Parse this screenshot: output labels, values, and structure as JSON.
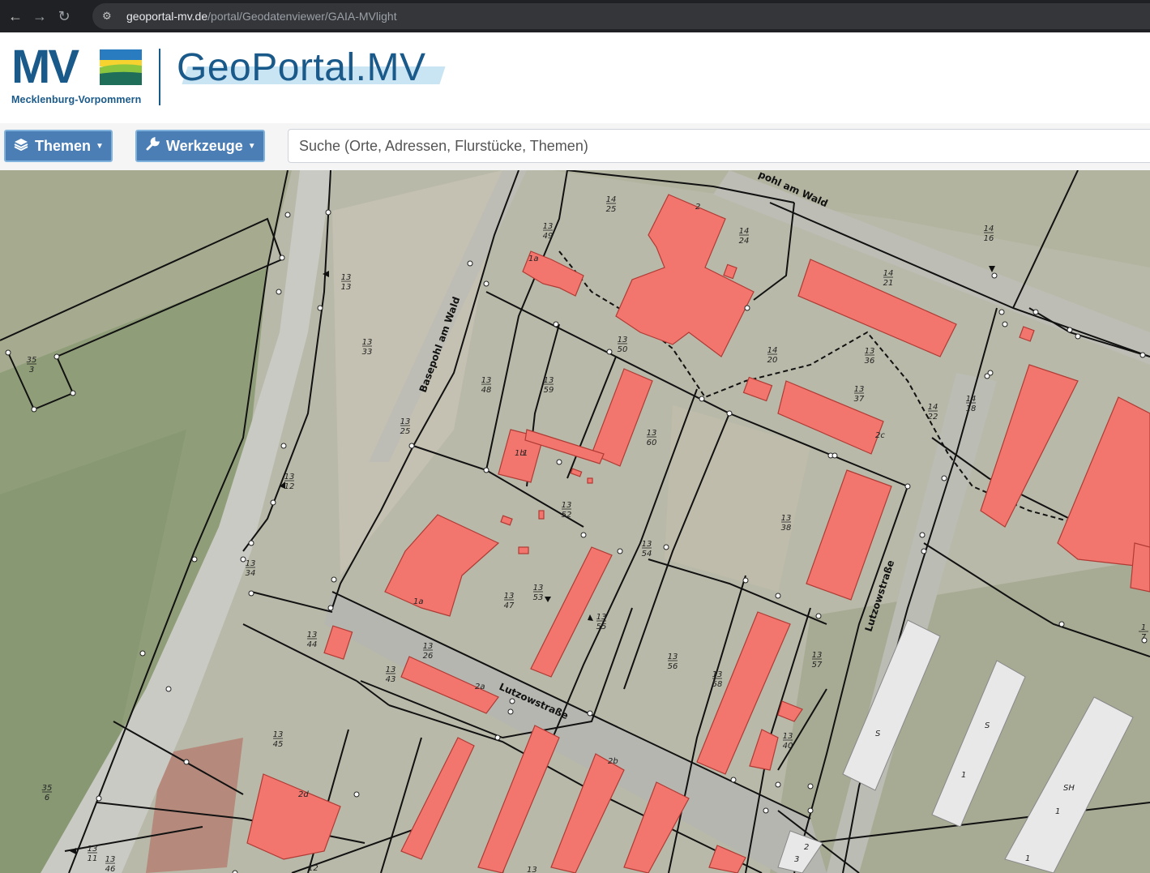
{
  "browser": {
    "url_host": "geoportal-mv.de",
    "url_path": "/portal/Geodatenviewer/GAIA-MVlight"
  },
  "header": {
    "logo_letters": "MV",
    "logo_subtitle": "Mecklenburg-Vorpommern",
    "portal_title": "GeoPortal.MV"
  },
  "toolbar": {
    "themen_label": "Themen",
    "werkzeuge_label": "Werkzeuge",
    "search_placeholder": "Suche (Orte, Adressen, Flurstücke, Themen)"
  },
  "map": {
    "streets": [
      "pohl am Wald",
      "Basepohl am Wald",
      "Lutzowstraße",
      "Lutzowstraße"
    ],
    "parcels": [
      {
        "top": "13",
        "bottom": "13"
      },
      {
        "top": "13",
        "bottom": "33"
      },
      {
        "top": "35",
        "bottom": "3"
      },
      {
        "top": "13",
        "bottom": "49"
      },
      {
        "top": "14",
        "bottom": "25"
      },
      {
        "top": "14",
        "bottom": "24"
      },
      {
        "top": "14",
        "bottom": "16"
      },
      {
        "top": "14",
        "bottom": "21"
      },
      {
        "top": "13",
        "bottom": "50"
      },
      {
        "top": "14",
        "bottom": "20"
      },
      {
        "top": "13",
        "bottom": "36"
      },
      {
        "top": "13",
        "bottom": "37"
      },
      {
        "top": "14",
        "bottom": "22"
      },
      {
        "top": "14",
        "bottom": "18"
      },
      {
        "top": "13",
        "bottom": "48"
      },
      {
        "top": "13",
        "bottom": "59"
      },
      {
        "top": "13",
        "bottom": "25"
      },
      {
        "top": "13",
        "bottom": "60"
      },
      {
        "top": "13",
        "bottom": "12"
      },
      {
        "top": "13",
        "bottom": "52"
      },
      {
        "top": "13",
        "bottom": "38"
      },
      {
        "top": "13",
        "bottom": "54"
      },
      {
        "top": "13",
        "bottom": "34"
      },
      {
        "top": "13",
        "bottom": "47"
      },
      {
        "top": "13",
        "bottom": "53"
      },
      {
        "top": "13",
        "bottom": "55"
      },
      {
        "top": "13",
        "bottom": "44"
      },
      {
        "top": "13",
        "bottom": "26"
      },
      {
        "top": "13",
        "bottom": "43"
      },
      {
        "top": "13",
        "bottom": "56"
      },
      {
        "top": "13",
        "bottom": "58"
      },
      {
        "top": "13",
        "bottom": "57"
      },
      {
        "top": "13",
        "bottom": "40"
      },
      {
        "top": "13",
        "bottom": "45"
      },
      {
        "top": "35",
        "bottom": "6"
      },
      {
        "top": "13",
        "bottom": "11"
      },
      {
        "top": "13",
        "bottom": "46"
      },
      {
        "top": "1",
        "bottom": "7"
      }
    ],
    "house_numbers": [
      "2",
      "1a",
      "1a",
      "2a",
      "2b",
      "2c",
      "2d",
      "1",
      "1b",
      "3",
      "S",
      "S",
      "SH",
      "1",
      "1",
      "1",
      "2",
      "12",
      "13"
    ],
    "colors": {
      "building": "#f2766e",
      "building_outline": "#b03a34",
      "parcel_line": "#111111",
      "grey_building": "#e8e8e8"
    }
  }
}
